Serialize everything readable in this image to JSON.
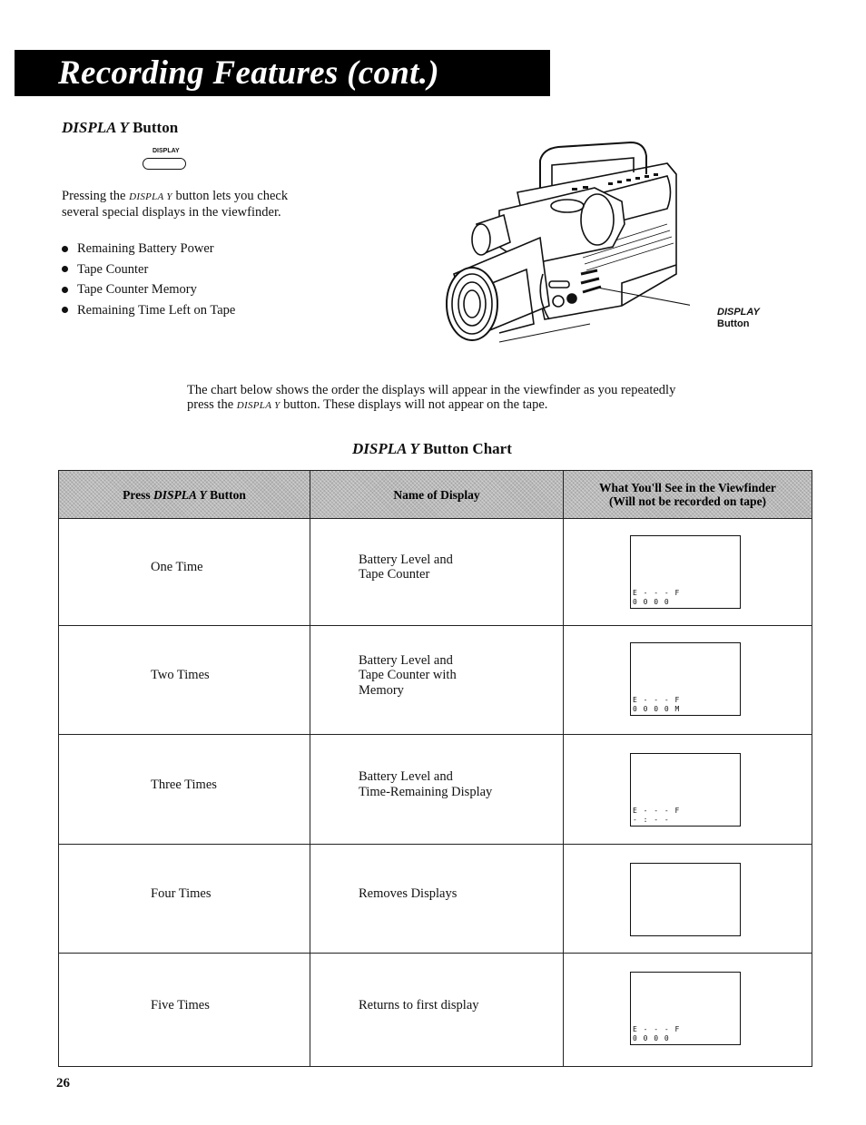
{
  "header": {
    "title": "Recording Features (cont.)"
  },
  "display_section": {
    "heading_italic": "DISPLA Y",
    "heading_rest": " Button",
    "button_label": "DISPLAY",
    "intro_pre": "Pressing the ",
    "intro_sc": "DISPLA Y",
    "intro_post": " button lets you check several special displays in the viewfinder.",
    "bullets": [
      "Remaining Battery Power",
      "Tape Counter",
      "Tape Counter Memory",
      "Remaining Time Left on Tape"
    ],
    "illustration": {
      "icon": "camcorder-icon",
      "callout_italic": "DISPLAY",
      "callout_rest": "Button"
    }
  },
  "chart_intro": {
    "pre": "The chart below shows the order the displays will appear in the viewfinder as you repeatedly press the ",
    "sc": "DISPLA Y",
    "post": " button. These displays will not appear on the tape."
  },
  "chart": {
    "title_italic": "DISPLA Y",
    "title_rest": " Button Chart",
    "headers": {
      "press_pre": "Press ",
      "press_it": "DISPLA Y",
      "press_post": " Button",
      "name": "Name of Display",
      "view_line1": "What You'll See in the Viewfinder",
      "view_line2": "(Will not be recorded on tape)"
    },
    "rows": [
      {
        "press": "One Time",
        "name_lines": [
          "Battery Level and",
          "Tape Counter"
        ],
        "viewfinder": [
          "E - - - F",
          "0 0 0 0"
        ]
      },
      {
        "press": "Two Times",
        "name_lines": [
          "Battery Level and",
          "Tape Counter with",
          "Memory"
        ],
        "viewfinder": [
          "E - - - F",
          "0 0 0 0 M"
        ]
      },
      {
        "press": "Three Times",
        "name_lines": [
          "Battery Level and",
          "Time-Remaining Display"
        ],
        "viewfinder": [
          "E - - - F",
          "- : - -"
        ]
      },
      {
        "press": "Four Times",
        "name_lines": [
          "Removes Displays"
        ],
        "viewfinder": []
      },
      {
        "press": "Five Times",
        "name_lines": [
          "Returns to first display"
        ],
        "viewfinder": [
          "E - - - F",
          "0 0 0 0"
        ]
      }
    ]
  },
  "footer": {
    "page_number": "26"
  }
}
